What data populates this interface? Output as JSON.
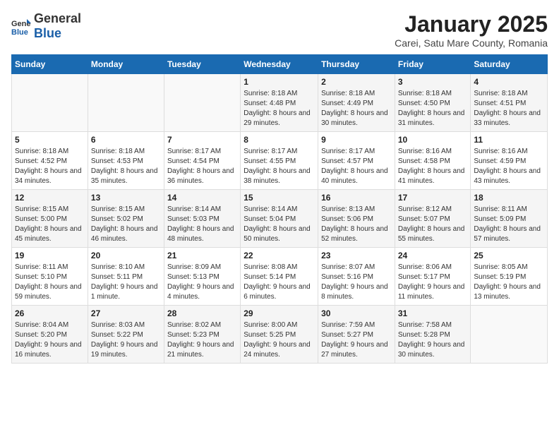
{
  "logo": {
    "text_general": "General",
    "text_blue": "Blue"
  },
  "title": "January 2025",
  "subtitle": "Carei, Satu Mare County, Romania",
  "days_of_week": [
    "Sunday",
    "Monday",
    "Tuesday",
    "Wednesday",
    "Thursday",
    "Friday",
    "Saturday"
  ],
  "weeks": [
    [
      {
        "day": "",
        "sunrise": "",
        "sunset": "",
        "daylight": ""
      },
      {
        "day": "",
        "sunrise": "",
        "sunset": "",
        "daylight": ""
      },
      {
        "day": "",
        "sunrise": "",
        "sunset": "",
        "daylight": ""
      },
      {
        "day": "1",
        "sunrise": "8:18 AM",
        "sunset": "4:48 PM",
        "daylight": "8 hours and 29 minutes."
      },
      {
        "day": "2",
        "sunrise": "8:18 AM",
        "sunset": "4:49 PM",
        "daylight": "8 hours and 30 minutes."
      },
      {
        "day": "3",
        "sunrise": "8:18 AM",
        "sunset": "4:50 PM",
        "daylight": "8 hours and 31 minutes."
      },
      {
        "day": "4",
        "sunrise": "8:18 AM",
        "sunset": "4:51 PM",
        "daylight": "8 hours and 33 minutes."
      }
    ],
    [
      {
        "day": "5",
        "sunrise": "8:18 AM",
        "sunset": "4:52 PM",
        "daylight": "8 hours and 34 minutes."
      },
      {
        "day": "6",
        "sunrise": "8:18 AM",
        "sunset": "4:53 PM",
        "daylight": "8 hours and 35 minutes."
      },
      {
        "day": "7",
        "sunrise": "8:17 AM",
        "sunset": "4:54 PM",
        "daylight": "8 hours and 36 minutes."
      },
      {
        "day": "8",
        "sunrise": "8:17 AM",
        "sunset": "4:55 PM",
        "daylight": "8 hours and 38 minutes."
      },
      {
        "day": "9",
        "sunrise": "8:17 AM",
        "sunset": "4:57 PM",
        "daylight": "8 hours and 40 minutes."
      },
      {
        "day": "10",
        "sunrise": "8:16 AM",
        "sunset": "4:58 PM",
        "daylight": "8 hours and 41 minutes."
      },
      {
        "day": "11",
        "sunrise": "8:16 AM",
        "sunset": "4:59 PM",
        "daylight": "8 hours and 43 minutes."
      }
    ],
    [
      {
        "day": "12",
        "sunrise": "8:15 AM",
        "sunset": "5:00 PM",
        "daylight": "8 hours and 45 minutes."
      },
      {
        "day": "13",
        "sunrise": "8:15 AM",
        "sunset": "5:02 PM",
        "daylight": "8 hours and 46 minutes."
      },
      {
        "day": "14",
        "sunrise": "8:14 AM",
        "sunset": "5:03 PM",
        "daylight": "8 hours and 48 minutes."
      },
      {
        "day": "15",
        "sunrise": "8:14 AM",
        "sunset": "5:04 PM",
        "daylight": "8 hours and 50 minutes."
      },
      {
        "day": "16",
        "sunrise": "8:13 AM",
        "sunset": "5:06 PM",
        "daylight": "8 hours and 52 minutes."
      },
      {
        "day": "17",
        "sunrise": "8:12 AM",
        "sunset": "5:07 PM",
        "daylight": "8 hours and 55 minutes."
      },
      {
        "day": "18",
        "sunrise": "8:11 AM",
        "sunset": "5:09 PM",
        "daylight": "8 hours and 57 minutes."
      }
    ],
    [
      {
        "day": "19",
        "sunrise": "8:11 AM",
        "sunset": "5:10 PM",
        "daylight": "8 hours and 59 minutes."
      },
      {
        "day": "20",
        "sunrise": "8:10 AM",
        "sunset": "5:11 PM",
        "daylight": "9 hours and 1 minute."
      },
      {
        "day": "21",
        "sunrise": "8:09 AM",
        "sunset": "5:13 PM",
        "daylight": "9 hours and 4 minutes."
      },
      {
        "day": "22",
        "sunrise": "8:08 AM",
        "sunset": "5:14 PM",
        "daylight": "9 hours and 6 minutes."
      },
      {
        "day": "23",
        "sunrise": "8:07 AM",
        "sunset": "5:16 PM",
        "daylight": "9 hours and 8 minutes."
      },
      {
        "day": "24",
        "sunrise": "8:06 AM",
        "sunset": "5:17 PM",
        "daylight": "9 hours and 11 minutes."
      },
      {
        "day": "25",
        "sunrise": "8:05 AM",
        "sunset": "5:19 PM",
        "daylight": "9 hours and 13 minutes."
      }
    ],
    [
      {
        "day": "26",
        "sunrise": "8:04 AM",
        "sunset": "5:20 PM",
        "daylight": "9 hours and 16 minutes."
      },
      {
        "day": "27",
        "sunrise": "8:03 AM",
        "sunset": "5:22 PM",
        "daylight": "9 hours and 19 minutes."
      },
      {
        "day": "28",
        "sunrise": "8:02 AM",
        "sunset": "5:23 PM",
        "daylight": "9 hours and 21 minutes."
      },
      {
        "day": "29",
        "sunrise": "8:00 AM",
        "sunset": "5:25 PM",
        "daylight": "9 hours and 24 minutes."
      },
      {
        "day": "30",
        "sunrise": "7:59 AM",
        "sunset": "5:27 PM",
        "daylight": "9 hours and 27 minutes."
      },
      {
        "day": "31",
        "sunrise": "7:58 AM",
        "sunset": "5:28 PM",
        "daylight": "9 hours and 30 minutes."
      },
      {
        "day": "",
        "sunrise": "",
        "sunset": "",
        "daylight": ""
      }
    ]
  ]
}
